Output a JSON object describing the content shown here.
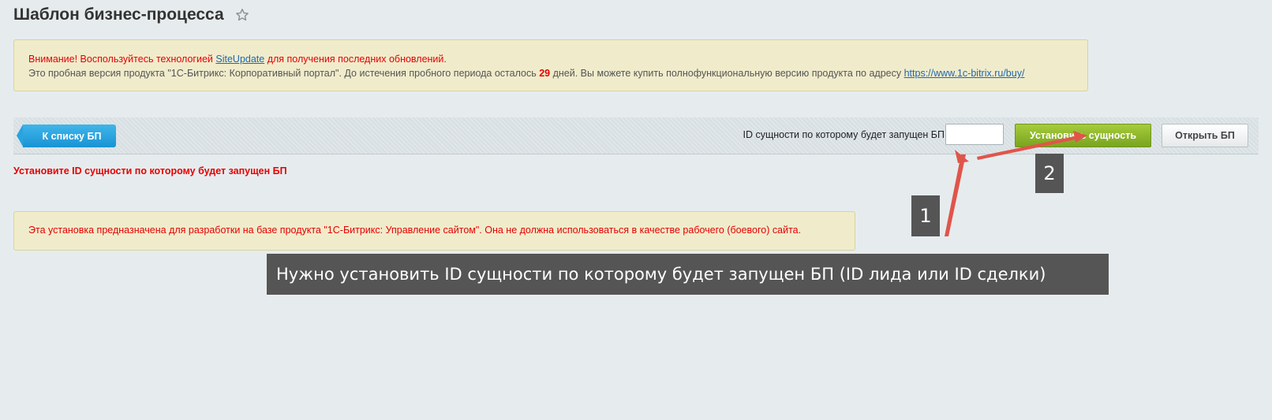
{
  "page": {
    "title": "Шаблон бизнес-процесса"
  },
  "notice_top": {
    "line1_prefix": "Внимание! Воспользуйтесь технологией ",
    "line1_link": "SiteUpdate",
    "line1_suffix": " для получения последних обновлений.",
    "line2_prefix": "Это пробная версия продукта \"1С-Битрикс: Корпоративный портал\". До истечения пробного периода осталось ",
    "line2_days": "29",
    "line2_middle": " дней. Вы можете купить полнофункциональную версию продукта по адресу ",
    "line2_link": "https://www.1c-bitrix.ru/buy/"
  },
  "toolbar": {
    "back_label": "К списку БП",
    "entity_label": "ID сущности по которому будет запущен БП",
    "entity_value": "",
    "set_label": "Установить сущность",
    "open_label": "Открыть БП"
  },
  "error": {
    "text": "Установите ID сущности по которому будет запущен БП"
  },
  "notice_bottom": {
    "text": "Эта установка предназначена для разработки на базе продукта \"1С-Битрикс: Управление сайтом\". Она не должна использоваться в качестве рабочего (боевого) сайта."
  },
  "annotations": {
    "badge1": "1",
    "badge2": "2",
    "callout": "Нужно установить ID сущности по которому будет запущен БП (ID лида или ID сделки)"
  },
  "colors": {
    "background": "#e6ecee",
    "notice_bg": "#f0eccb",
    "error_red": "#e60000",
    "link_blue": "#2067b0",
    "back_button_blue": "#1a93d3",
    "set_button_green": "#8db52c",
    "annotation_gray": "#555555",
    "arrow_red": "#e0554a"
  },
  "icons": {
    "favorite": "star-outline-icon"
  }
}
